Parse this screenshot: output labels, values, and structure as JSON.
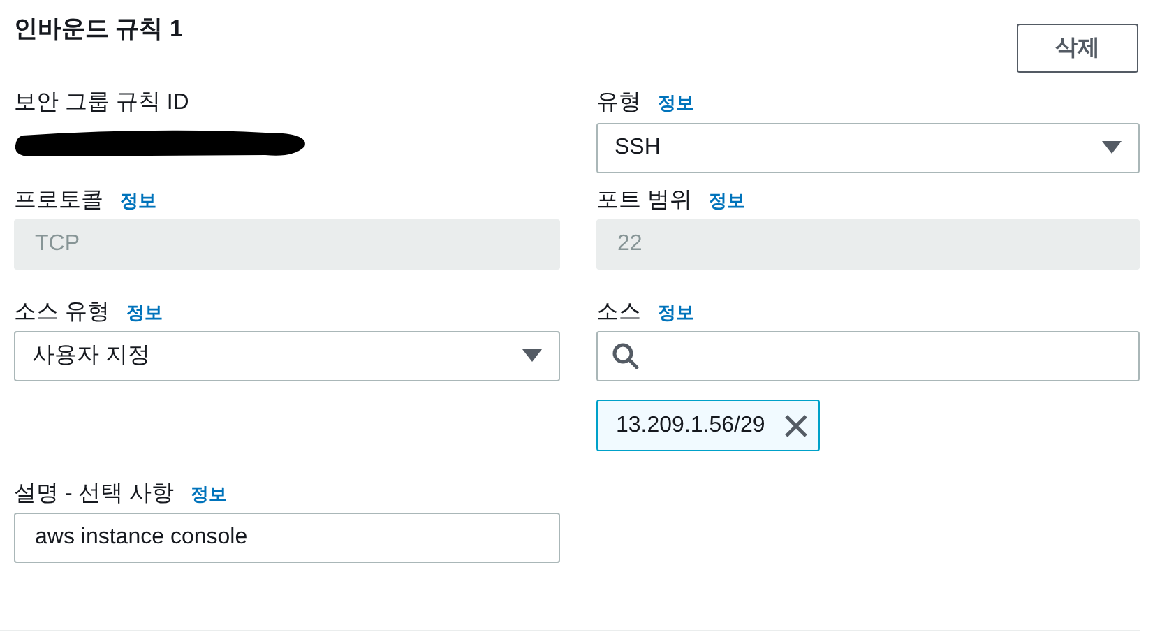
{
  "title": "인바운드 규칙 1",
  "delete_button": "삭제",
  "rule_id": {
    "label": "보안 그룹 규칙 ID"
  },
  "type": {
    "label": "유형",
    "info": "정보",
    "value": "SSH"
  },
  "protocol": {
    "label": "프로토콜",
    "info": "정보",
    "value": "TCP",
    "disabled": true
  },
  "port_range": {
    "label": "포트 범위",
    "info": "정보",
    "value": "22",
    "disabled": true
  },
  "source_type": {
    "label": "소스 유형",
    "info": "정보",
    "value": "사용자 지정"
  },
  "source": {
    "label": "소스",
    "info": "정보",
    "tokens": [
      "13.209.1.56/29"
    ]
  },
  "description": {
    "label": "설명 - 선택 사항",
    "info": "정보",
    "value": "aws instance console"
  }
}
